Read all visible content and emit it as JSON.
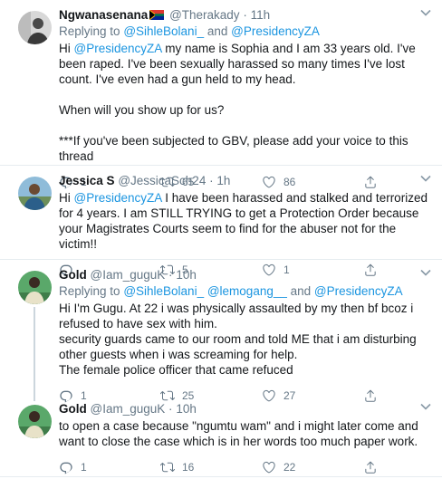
{
  "tweets": [
    {
      "name": "Ngwanasenana",
      "handle": "@Therakady",
      "time": "11h",
      "replying_label": "Replying to",
      "mentions": [
        "@SihleBolani_",
        "@PresidencyZA"
      ],
      "and": "and",
      "body": {
        "hi": "Hi",
        "mention": "@PresidencyZA",
        "rest": " my name is Sophia and I am 33 years old. I've been raped. I've been sexually harassed so many times I've lost count. I've even had a gun held to my head.",
        "p2": "When will you show up for us?",
        "p3": "***If you've been subjected to GBV, please add your voice to this thread"
      },
      "replies": "1",
      "retweets": "65",
      "likes": "86"
    },
    {
      "name": "Jessica S",
      "handle": "@JessicaSch24",
      "time": "1h",
      "body": {
        "hi": "Hi",
        "mention": "@PresidencyZA",
        "rest": " I have been harassed and stalked and terrorized for 4 years. I am STILL TRYING to get a Protection Order because your Magistrates Courts seem to find for the abuser not for the victim!!"
      },
      "replies": "",
      "retweets": "5",
      "likes": "1"
    },
    {
      "name": "Gold",
      "handle": "@Iam_guguK",
      "time": "10h",
      "replying_label": "Replying to",
      "mentions": [
        "@SihleBolani_",
        "@lemogang__",
        "@PresidencyZA"
      ],
      "and": "and",
      "body": {
        "l1": "Hi I'm Gugu. At 22 i was physically assaulted by my then bf bcoz i refused to have sex with him.",
        "l2": "security guards came to our room and told ME that i am disturbing other guests when i was screaming for help.",
        "l3": "The female police officer that came refuced"
      },
      "replies": "1",
      "retweets": "25",
      "likes": "27"
    },
    {
      "name": "Gold",
      "handle": "@Iam_guguK",
      "time": "10h",
      "body": {
        "l1": "to open a case because \"ngumtu wam\" and i might later come and want to close the case which is in her words too much paper work."
      },
      "replies": "1",
      "retweets": "16",
      "likes": "22"
    }
  ],
  "separator": "·",
  "colors": {
    "accent": "#1b95e0",
    "muted": "#657786",
    "text": "#14171a",
    "border": "#e6ecf0"
  }
}
